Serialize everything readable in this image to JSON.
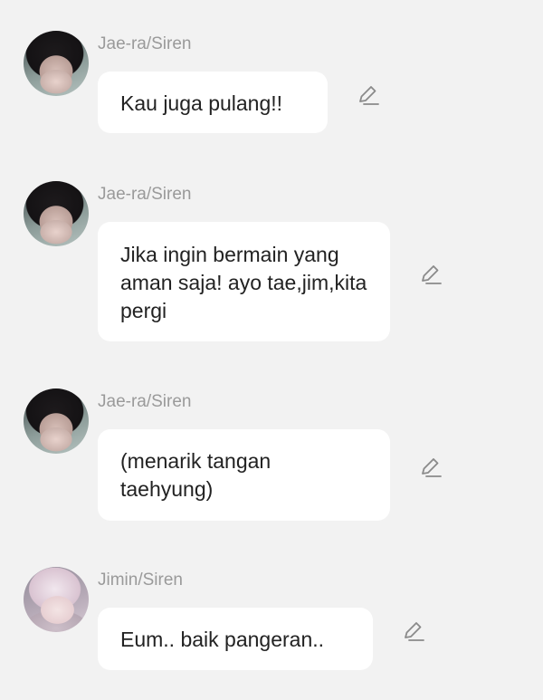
{
  "messages": [
    {
      "sender": "Jae-ra/Siren",
      "avatar_icon": "character-avatar-icon",
      "text": "Kau juga pulang!!",
      "edit_icon": "pencil-edit-icon"
    },
    {
      "sender": "Jae-ra/Siren",
      "avatar_icon": "character-avatar-icon",
      "text": "Jika ingin bermain yang aman saja! ayo tae,jim,kita pergi",
      "edit_icon": "pencil-edit-icon"
    },
    {
      "sender": "Jae-ra/Siren",
      "avatar_icon": "character-avatar-icon",
      "text": "(menarik tangan taehyung)",
      "edit_icon": "pencil-edit-icon"
    },
    {
      "sender": "Jimin/Siren",
      "avatar_icon": "character-avatar-icon",
      "text": "Eum.. baik pangeran..",
      "edit_icon": "pencil-edit-icon"
    }
  ],
  "colors": {
    "background": "#f2f2f2",
    "bubble": "#ffffff",
    "sender_name": "#9a9a9a",
    "message_text": "#222222",
    "icon": "#8a8a8a"
  }
}
